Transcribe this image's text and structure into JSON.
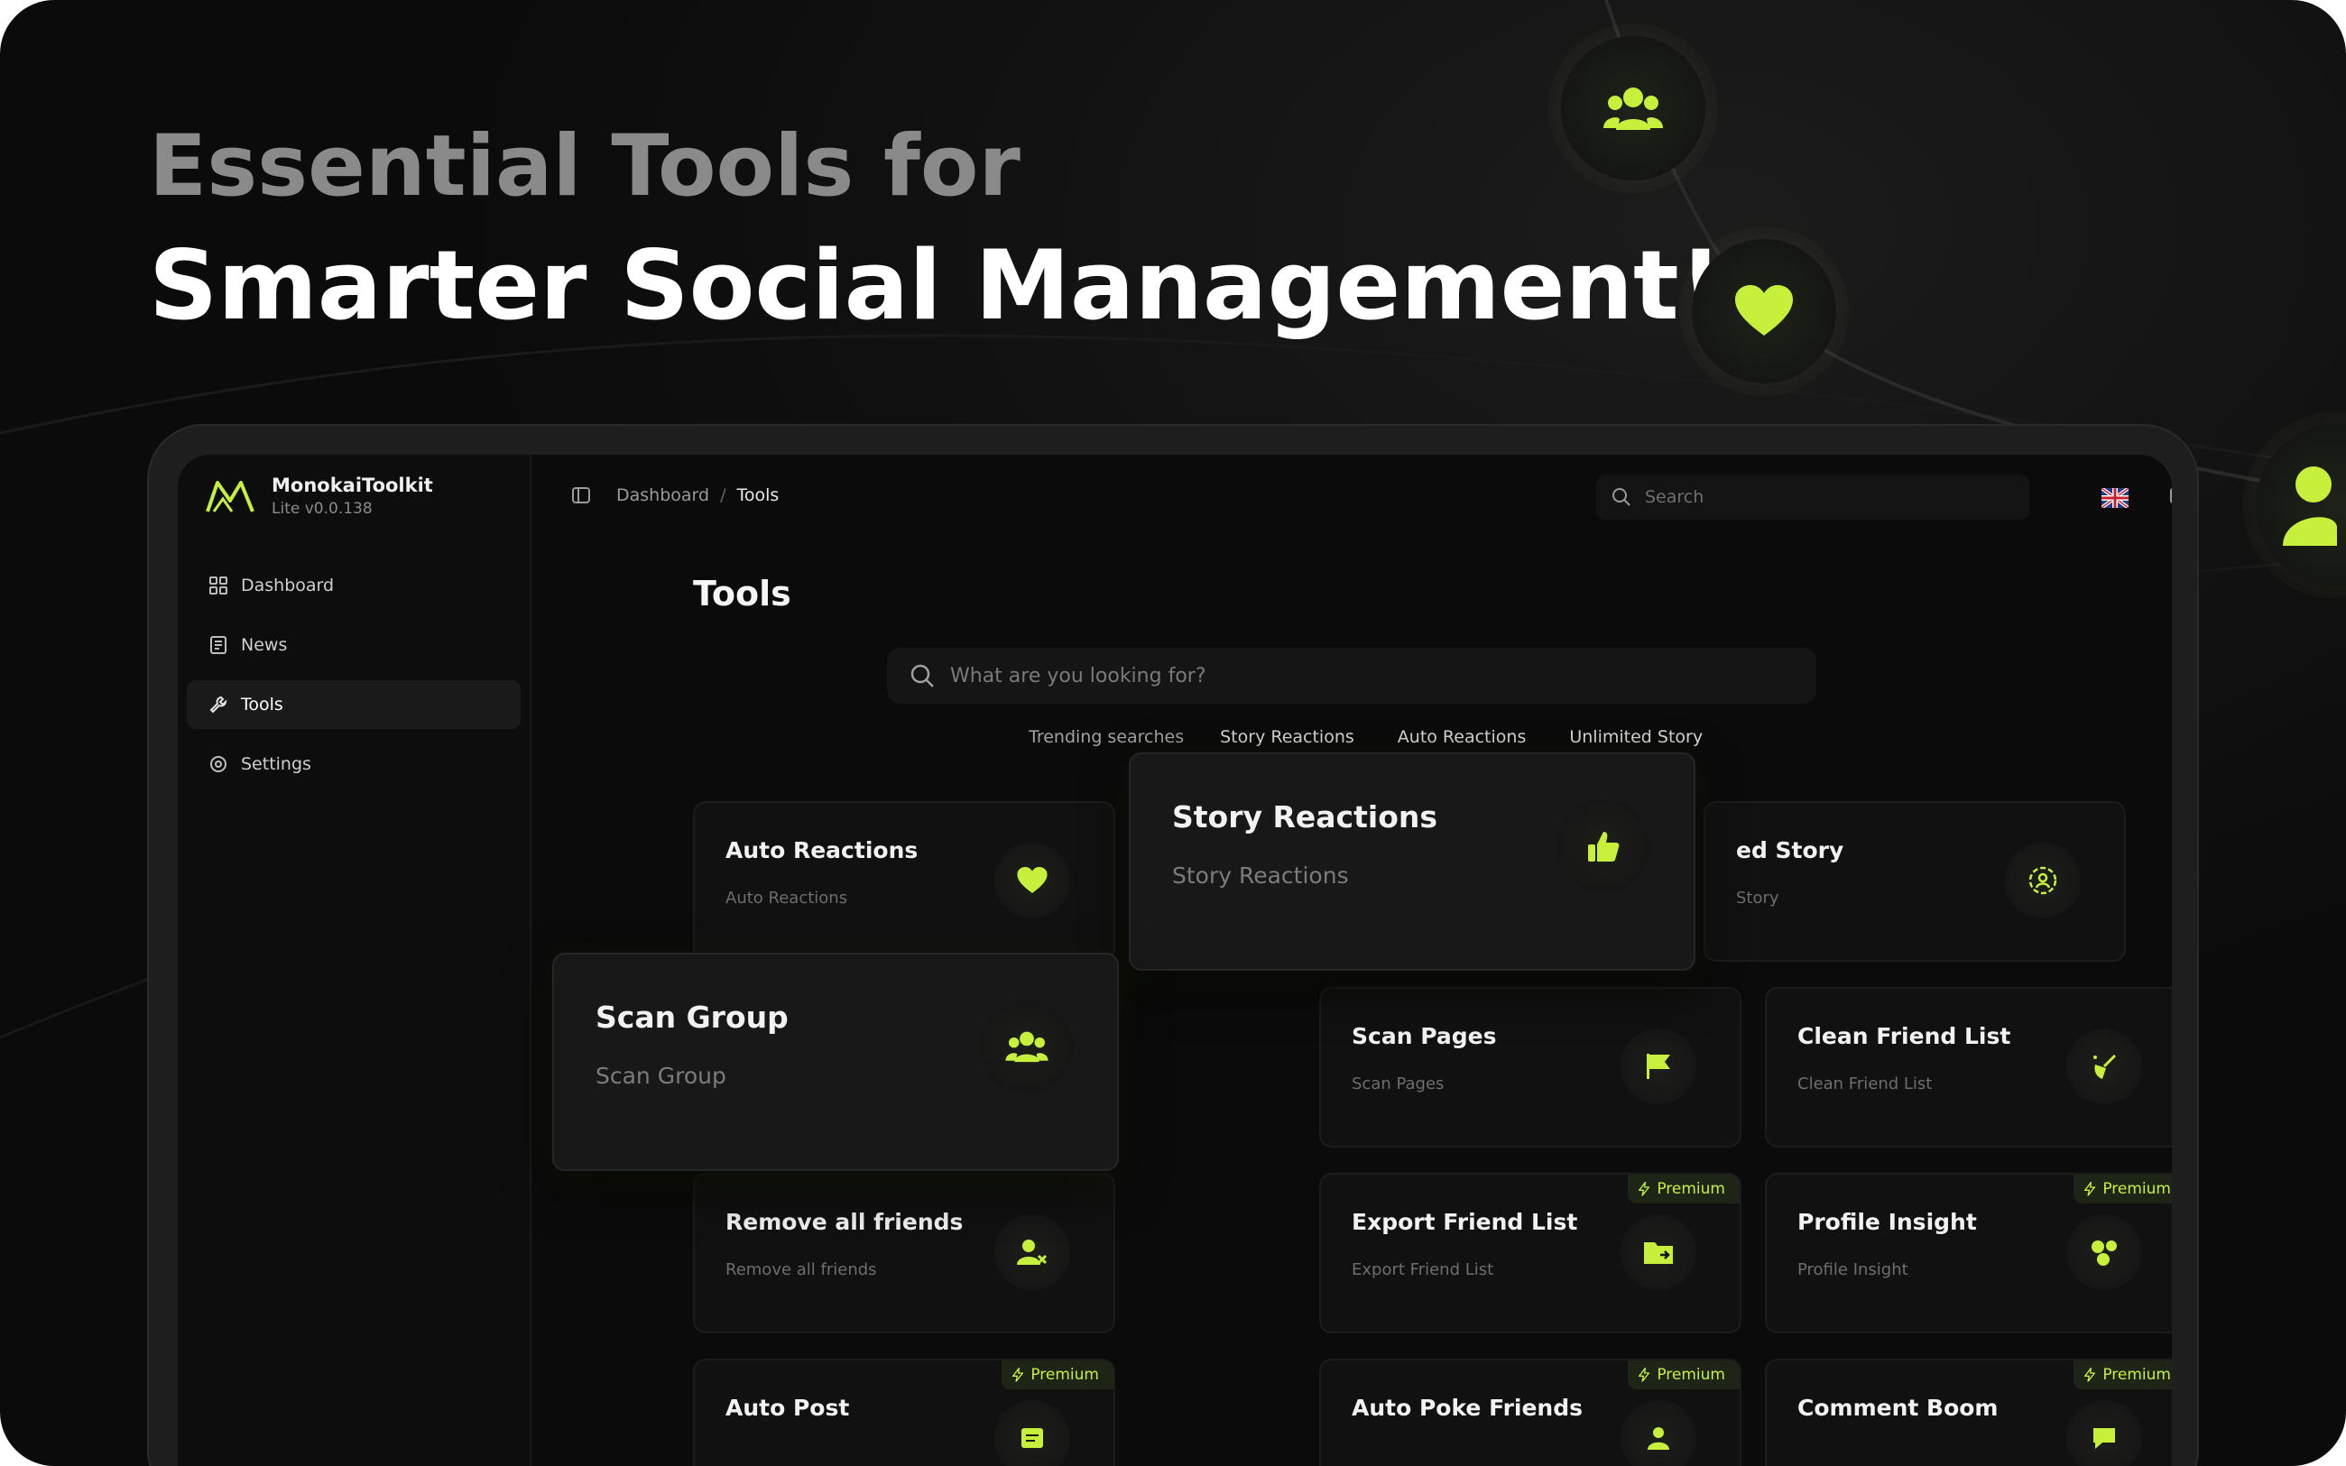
{
  "hero": {
    "line1": "Essential Tools for",
    "line2": "Smarter Social Management!"
  },
  "app": {
    "name": "MonokaiToolkit",
    "version": "Lite v0.0.138"
  },
  "sidebar": {
    "items": [
      {
        "label": "Dashboard",
        "icon": "grid-icon"
      },
      {
        "label": "News",
        "icon": "newspaper-icon"
      },
      {
        "label": "Tools",
        "icon": "wrench-icon",
        "active": true
      },
      {
        "label": "Settings",
        "icon": "settings-icon"
      }
    ]
  },
  "topbar": {
    "breadcrumb": [
      "Dashboard",
      "Tools"
    ],
    "search_placeholder": "Search"
  },
  "page": {
    "title": "Tools",
    "search_placeholder": "What are you looking for?",
    "trending_label": "Trending searches",
    "trending": [
      "Story Reactions",
      "Auto Reactions",
      "Unlimited Story"
    ]
  },
  "cards": {
    "auto_reactions": {
      "title": "Auto Reactions",
      "sub": "Auto Reactions"
    },
    "story_reactions": {
      "title": "Story Reactions",
      "sub": "Story Reactions"
    },
    "unlimited_story": {
      "title": "ed Story",
      "sub": "Story"
    },
    "scan_group": {
      "title": "Scan Group",
      "sub": "Scan Group"
    },
    "scan_pages": {
      "title": "Scan Pages",
      "sub": "Scan Pages"
    },
    "clean_friend_list": {
      "title": "Clean Friend List",
      "sub": "Clean Friend List"
    },
    "remove_all_friends": {
      "title": "Remove all friends",
      "sub": "Remove all friends"
    },
    "export_friend_list": {
      "title": "Export Friend List",
      "sub": "Export Friend List",
      "badge": "Premium"
    },
    "profile_insight": {
      "title": "Profile Insight",
      "sub": "Profile Insight",
      "badge": "Premium"
    },
    "auto_post": {
      "title": "Auto Post",
      "badge": "Premium"
    },
    "auto_poke_friends": {
      "title": "Auto Poke Friends",
      "badge": "Premium"
    },
    "comment_boom": {
      "title": "Comment Boom",
      "badge": "Premium"
    }
  },
  "colors": {
    "accent": "#c7f03c",
    "background": "#0b0b0b",
    "card": "#111111"
  }
}
